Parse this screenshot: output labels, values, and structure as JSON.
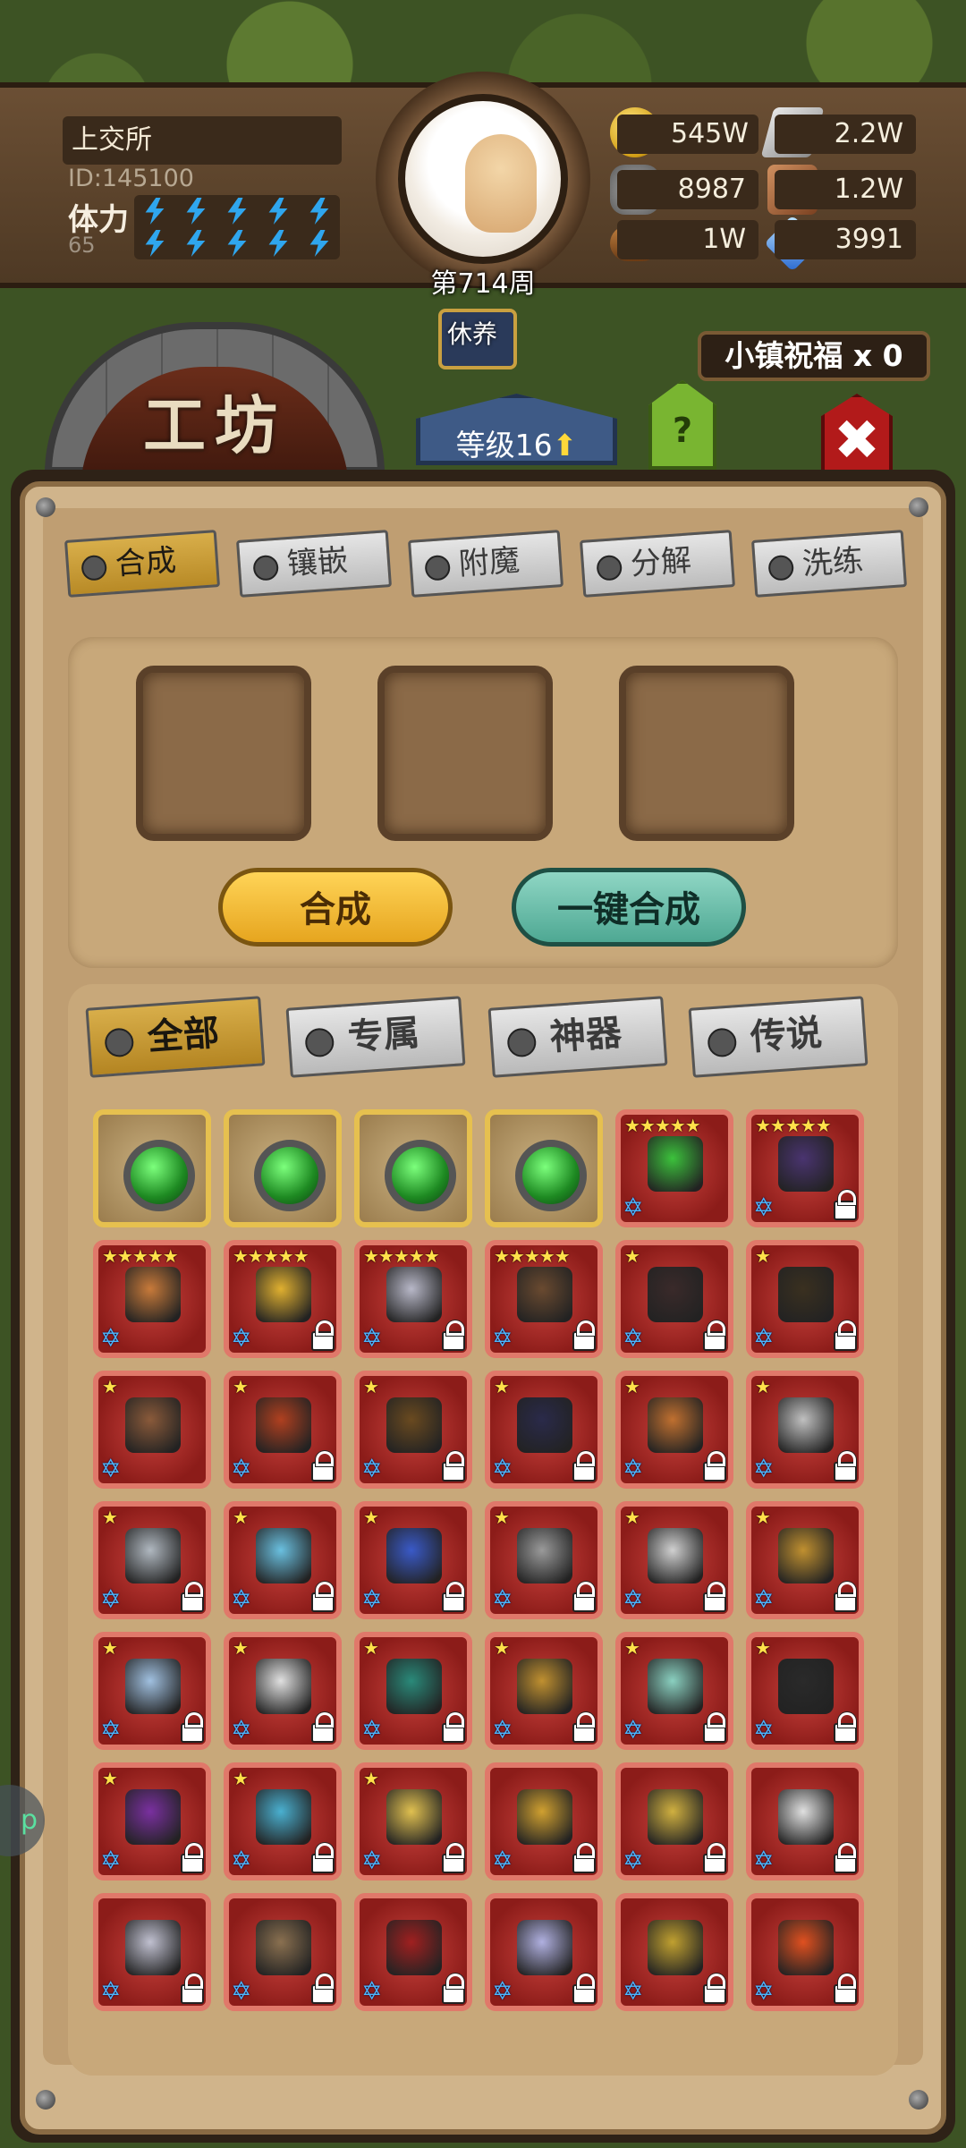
{
  "player": {
    "name": "上交所",
    "id": "ID:145100",
    "stamina_label": "体力",
    "stamina_value": "65",
    "week": "第714周"
  },
  "resources": [
    {
      "icon": "gold-coin-icon",
      "value": "545W"
    },
    {
      "icon": "iron-ingot-icon",
      "value": "2.2W"
    },
    {
      "icon": "stone-ore-icon",
      "value": "8987"
    },
    {
      "icon": "leather-icon",
      "value": "1.2W"
    },
    {
      "icon": "wood-log-icon",
      "value": "1W"
    },
    {
      "icon": "crystal-icon",
      "value": "3991"
    }
  ],
  "top": {
    "workshop_title": "工坊",
    "rest_label": "休养",
    "level_label": "等级16",
    "help_label": "?",
    "town_blessing": "小镇祝福 x 0",
    "close_label": "✖"
  },
  "mode_tabs": [
    {
      "label": "合成",
      "active": true
    },
    {
      "label": "镶嵌",
      "active": false
    },
    {
      "label": "附魔",
      "active": false
    },
    {
      "label": "分解",
      "active": false
    },
    {
      "label": "洗练",
      "active": false
    }
  ],
  "actions": {
    "combine": "合成",
    "one_click_combine": "一键合成"
  },
  "category_tabs": [
    {
      "label": "全部",
      "active": true
    },
    {
      "label": "专属",
      "active": false
    },
    {
      "label": "神器",
      "active": false
    },
    {
      "label": "传说",
      "active": false
    }
  ],
  "side_bubble": "p",
  "items": [
    {
      "kind": "gem",
      "stars": 0,
      "locked": false,
      "color": "#2aa82a"
    },
    {
      "kind": "gem",
      "stars": 0,
      "locked": false,
      "color": "#2aa82a"
    },
    {
      "kind": "gem",
      "stars": 0,
      "locked": false,
      "color": "#2aa82a"
    },
    {
      "kind": "gem",
      "stars": 0,
      "locked": false,
      "color": "#2aa82a"
    },
    {
      "kind": "potion",
      "stars": 5,
      "locked": false,
      "color": "#3cc23c"
    },
    {
      "kind": "cloak",
      "stars": 5,
      "locked": true,
      "color": "#4a3470"
    },
    {
      "kind": "axe",
      "stars": 5,
      "locked": false,
      "color": "#c87a3a"
    },
    {
      "kind": "ring",
      "stars": 5,
      "locked": true,
      "color": "#e0b030"
    },
    {
      "kind": "armor",
      "stars": 5,
      "locked": true,
      "color": "#b8b8c8"
    },
    {
      "kind": "gun",
      "stars": 5,
      "locked": true,
      "color": "#6a4a30"
    },
    {
      "kind": "crossbow",
      "stars": 1,
      "locked": true,
      "color": "#3a2a2a"
    },
    {
      "kind": "pickaxe",
      "stars": 1,
      "locked": true,
      "color": "#3a3020"
    },
    {
      "kind": "shield",
      "stars": 1,
      "locked": false,
      "color": "#8a5a3a"
    },
    {
      "kind": "shuriken",
      "stars": 1,
      "locked": true,
      "color": "#b04020"
    },
    {
      "kind": "bow",
      "stars": 1,
      "locked": true,
      "color": "#6a4a20"
    },
    {
      "kind": "bow",
      "stars": 1,
      "locked": true,
      "color": "#2a2a4a"
    },
    {
      "kind": "armor",
      "stars": 1,
      "locked": true,
      "color": "#c07030"
    },
    {
      "kind": "axe",
      "stars": 1,
      "locked": true,
      "color": "#c0c0c0"
    },
    {
      "kind": "rifle",
      "stars": 1,
      "locked": true,
      "color": "#b0b8c0"
    },
    {
      "kind": "spear",
      "stars": 1,
      "locked": true,
      "color": "#6ac0e0"
    },
    {
      "kind": "staff",
      "stars": 1,
      "locked": true,
      "color": "#3a5ac8"
    },
    {
      "kind": "blade",
      "stars": 1,
      "locked": true,
      "color": "#9a9a9a"
    },
    {
      "kind": "cleaver",
      "stars": 1,
      "locked": true,
      "color": "#d0d0d0"
    },
    {
      "kind": "armor",
      "stars": 1,
      "locked": true,
      "color": "#c09030"
    },
    {
      "kind": "sword",
      "stars": 1,
      "locked": true,
      "color": "#a0c0e0"
    },
    {
      "kind": "katana",
      "stars": 1,
      "locked": true,
      "color": "#e0e0e0"
    },
    {
      "kind": "tome",
      "stars": 1,
      "locked": true,
      "color": "#2a8a7a"
    },
    {
      "kind": "rapier",
      "stars": 1,
      "locked": true,
      "color": "#c09030"
    },
    {
      "kind": "scepter",
      "stars": 1,
      "locked": true,
      "color": "#8ad0c0"
    },
    {
      "kind": "wand",
      "stars": 1,
      "locked": true,
      "color": "#2a2a2a"
    },
    {
      "kind": "dagger",
      "stars": 1,
      "locked": true,
      "color": "#7a30a0"
    },
    {
      "kind": "orb",
      "stars": 1,
      "locked": true,
      "color": "#4ab0d0"
    },
    {
      "kind": "sword",
      "stars": 1,
      "locked": true,
      "color": "#e0c050"
    },
    {
      "kind": "helmet",
      "stars": 0,
      "locked": true,
      "color": "#d0a030"
    },
    {
      "kind": "axe",
      "stars": 0,
      "locked": true,
      "color": "#d0b040"
    },
    {
      "kind": "armor",
      "stars": 0,
      "locked": true,
      "color": "#e0e0e0"
    },
    {
      "kind": "shield",
      "stars": 0,
      "locked": true,
      "color": "#c0c0d0"
    },
    {
      "kind": "hammer",
      "stars": 0,
      "locked": true,
      "color": "#8a7050"
    },
    {
      "kind": "blade",
      "stars": 0,
      "locked": true,
      "color": "#a02020"
    },
    {
      "kind": "sword",
      "stars": 0,
      "locked": true,
      "color": "#b0b0e0"
    },
    {
      "kind": "bag",
      "stars": 0,
      "locked": true,
      "color": "#c0a030"
    },
    {
      "kind": "heart",
      "stars": 0,
      "locked": true,
      "color": "#e05020"
    }
  ]
}
